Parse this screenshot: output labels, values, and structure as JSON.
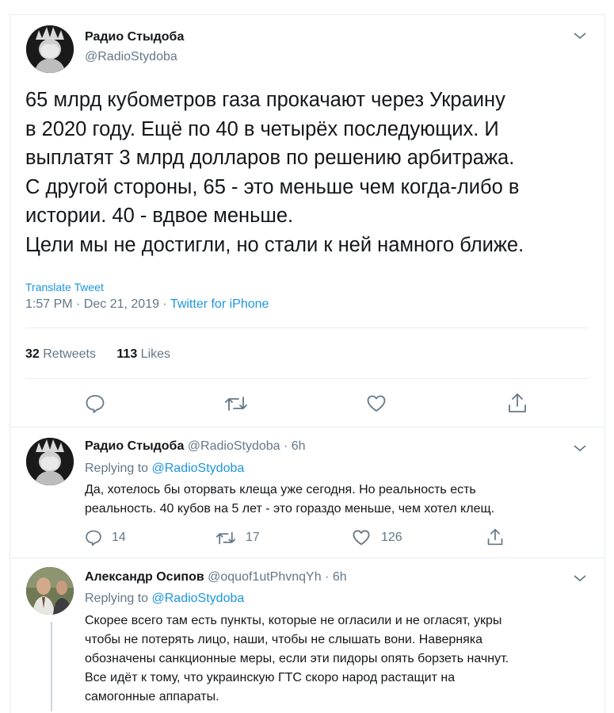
{
  "tweet": {
    "author_name": "Радио Стыдоба",
    "author_handle": "@RadioStydoba",
    "lines": [
      "65 млрд кубометров газа прокачают через Украину",
      "в 2020 году. Ещё по 40 в четырёх последующих. И",
      "выплатят 3 млрд долларов по решению арбитража.",
      "С другой стороны, 65 - это меньше чем когда-либо в",
      "истории. 40 - вдвое меньше.",
      "Цели мы не достигли, но стали к ней намного ближе."
    ],
    "translate_label": "Translate Tweet",
    "timestamp": "1:57 PM · Dec 21, 2019 · ",
    "source": "Twitter for iPhone",
    "retweets_count": "32",
    "retweets_label": "Retweets",
    "likes_count": "113",
    "likes_label": "Likes"
  },
  "replies": [
    {
      "author_name": "Радио Стыдоба",
      "author_handle": "@RadioStydoba",
      "time": " · 6h",
      "replying_prefix": "Replying to ",
      "replying_handle": "@RadioStydoba",
      "lines": [
        "Да, хотелось бы оторвать клеща уже сегодня. Но реальность есть",
        "реальность. 40 кубов на 5 лет - это гораздо меньше, чем хотел клещ."
      ],
      "reply_count": "14",
      "retweet_count": "17",
      "like_count": "126"
    },
    {
      "author_name": "Александр Осипов",
      "author_handle": "@oquof1utPhvnqYh",
      "time": " · 6h",
      "replying_prefix": "Replying to ",
      "replying_handle": "@RadioStydoba",
      "lines": [
        "Скорее всего там есть пункты, которые не огласили и не огласят, укры",
        "чтобы не потерять лицо, наши, чтобы не слышать вони. Наверняка",
        "обозначены санкционные меры, если эти пидоры опять борзеть начнут.",
        "Все идёт к тому, что украинскую ГТС скоро народ растащит на",
        "самогонные аппараты."
      ]
    }
  ],
  "colors": {
    "accent": "#1b95e0",
    "muted": "#657786",
    "text": "#14171a",
    "border": "#e6ecf0"
  }
}
